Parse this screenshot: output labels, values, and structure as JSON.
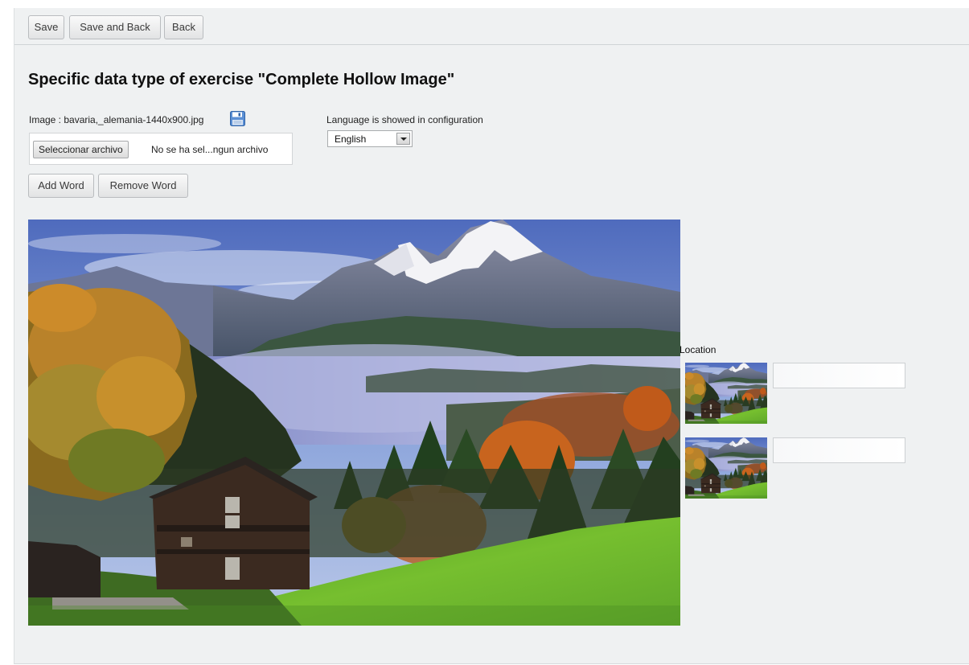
{
  "toolbar": {
    "save_label": "Save",
    "save_back_label": "Save and Back",
    "back_label": "Back"
  },
  "page": {
    "title": "Specific data type of exercise \"Complete Hollow Image\""
  },
  "image_field": {
    "label": "Image : bavaria,_alemania-1440x900.jpg",
    "icon": "floppy-disk-icon",
    "choose_file_label": "Seleccionar archivo",
    "no_file_text": "No se ha sel...ngun archivo"
  },
  "language": {
    "label": "Language is showed in configuration",
    "selected": "English"
  },
  "word_actions": {
    "add_label": "Add Word",
    "remove_label": "Remove Word"
  },
  "location": {
    "label": "Location",
    "words": [
      {
        "value": ""
      },
      {
        "value": ""
      }
    ]
  },
  "colors": {
    "panel_background": "#eff1f2",
    "sky": "#5d79c6",
    "grass": "#6cb52d",
    "autumn_foliage": "#c8641e"
  }
}
